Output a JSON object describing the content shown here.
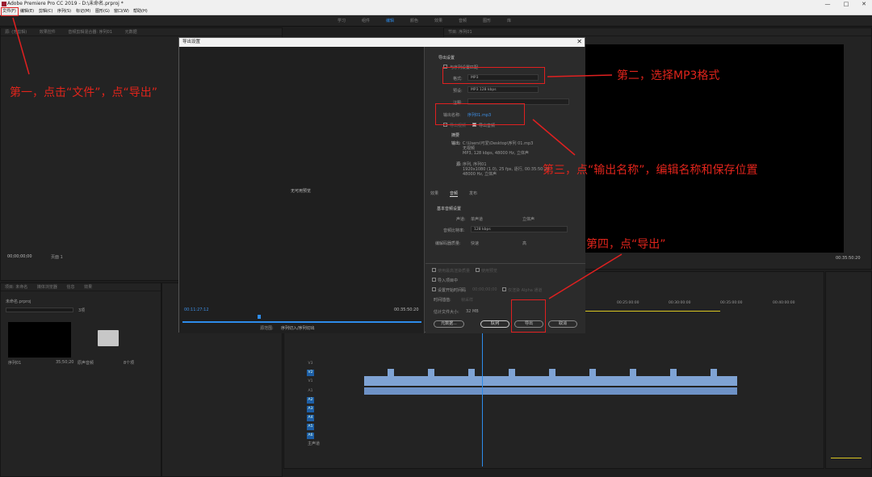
{
  "app": {
    "title": "Adobe Premiere Pro CC 2019 - D:\\未命名.prproj *",
    "window_controls": [
      "—",
      "□",
      "✕"
    ]
  },
  "menu": [
    "文件(F)",
    "编辑(E)",
    "剪辑(C)",
    "序列(S)",
    "标记(M)",
    "图形(G)",
    "窗口(W)",
    "帮助(H)"
  ],
  "workspaces": {
    "items": [
      "学习",
      "组件",
      "编辑",
      "颜色",
      "效果",
      "音频",
      "图形",
      "库"
    ],
    "active_index": 2
  },
  "source_panel": {
    "tabs": [
      "源: (无剪辑)",
      "效果控件",
      "音频剪辑混合器: 序列01",
      "元数据"
    ],
    "timecode": "00;00;00;00",
    "page": "页面 1"
  },
  "program_panel": {
    "tab": "节目: 序列01",
    "timecode": "00:35:50:20"
  },
  "project_panel": {
    "tabs": [
      "项目: 未命名",
      "媒体浏览器",
      "信息",
      "效果"
    ],
    "project_file": "未命名.prproj",
    "count": "3项",
    "items": [
      {
        "name": "序列01",
        "duration": "35;50;20"
      },
      {
        "name": "原声音频",
        "duration": ""
      },
      {
        "name": "8个项",
        "duration": ""
      }
    ]
  },
  "dialog": {
    "title": "导出设置",
    "close": "✕",
    "preview_text": "无可用预览",
    "timecode_in": "00:11:27:12",
    "timecode_out": "00:35:50:20",
    "source_range_label": "源范围:",
    "source_range_value": "序列切入/序列切出",
    "section_export": "导出设置",
    "match_sequence": "与序列设置匹配",
    "format_label": "格式:",
    "format_value": "MP3",
    "preset_label": "预设:",
    "preset_value": "MP3 128 kbps",
    "comment_label": "注释:",
    "output_name_label": "输出名称:",
    "output_name_value": "序列01.mp3",
    "export_video": "导出视频",
    "export_audio": "导出音频",
    "summary_title": "摘要",
    "summary_output_label": "输出:",
    "summary_output": [
      "C:\\Users\\可爱\\Desktop\\序列 01.mp3",
      "无视频",
      "MP3, 128 kbps, 48000 Hz, 立体声"
    ],
    "summary_source_label": "源:",
    "summary_source": [
      "序列, 序列01",
      "1920x1080 (1.0), 25 fps, 逐行, 00:35:50:20",
      "48000 Hz, 立体声"
    ],
    "tabs": [
      "效果",
      "音频",
      "发布"
    ],
    "active_tab": 1,
    "audio_section": "基本音频设置",
    "channel_label": "声道:",
    "channel_mono": "单声道",
    "channel_stereo": "立体声",
    "bitrate_label": "音频比特率:",
    "bitrate_value": "128 kbps",
    "encoder_label": "编解码器质量:",
    "encoder_fast": "快速",
    "encoder_high": "高",
    "max_render_depth": "使用最高渲染质量",
    "use_preview": "使用预览",
    "import_project": "导入项目中",
    "set_start_timecode": "设置开始时间码",
    "timecode_placeholder": "00;00;00;00",
    "render_alpha": "仅渲染 Alpha 通道",
    "interpolation_label": "时间插值:",
    "interpolation_value": "帧采样",
    "estimated_size_label": "估计文件大小:",
    "estimated_size": "32 MB",
    "buttons": {
      "metadata": "元数据...",
      "queue": "队列",
      "export": "导出",
      "cancel": "取消"
    }
  },
  "timeline": {
    "ruler": [
      "00:25:00:00",
      "00:30:00:00",
      "00:35:00:00",
      "00:40:00:00"
    ],
    "video_tracks": [
      "V3",
      "V2",
      "V1"
    ],
    "audio_tracks": [
      "A1",
      "A2",
      "A3",
      "A4",
      "A5",
      "A6"
    ],
    "master": "主声道"
  },
  "annotations": {
    "step1": "第一，点击“文件”，点“导出”",
    "step2": "第二，选择MP3格式",
    "step3": "第三，点“输出名称”，编辑名称和保存位置",
    "step4": "第四，点“导出”"
  },
  "colors": {
    "annotation": "#e0241b",
    "accent_blue": "#2d8ceb"
  }
}
